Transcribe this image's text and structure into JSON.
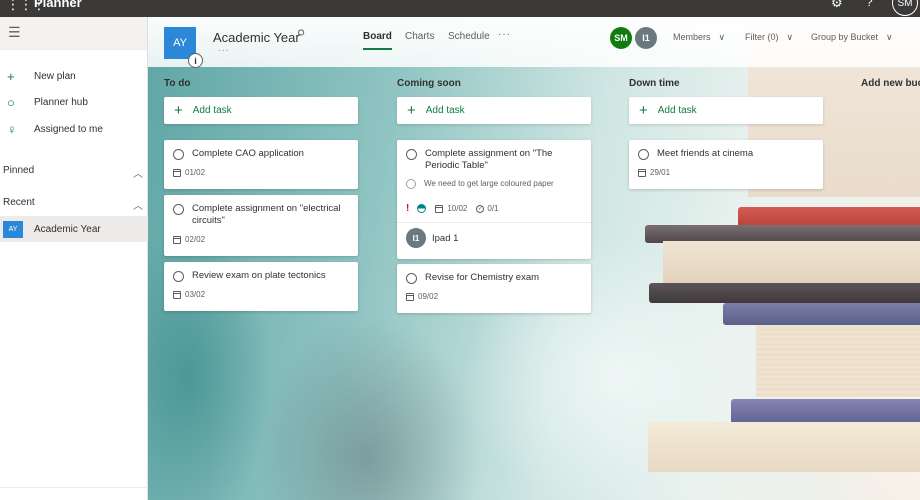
{
  "app": {
    "name": "Planner",
    "waffle_icon": "waffle-icon",
    "settings_icon": "gear-icon",
    "help_label": "?",
    "user_initials": "SM"
  },
  "sidebar": {
    "menu_icon": "hamburger-icon",
    "items": [
      {
        "label": "New plan",
        "icon": "plus-icon",
        "glyph": "+"
      },
      {
        "label": "Planner hub",
        "icon": "circle-icon",
        "glyph": "○"
      },
      {
        "label": "Assigned to me",
        "icon": "person-icon",
        "glyph": "♀"
      }
    ],
    "pinned_label": "Pinned",
    "recent_label": "Recent",
    "recent_items": [
      {
        "initials": "AY",
        "label": "Academic Year"
      }
    ]
  },
  "header": {
    "plan_initials": "AY",
    "plan_title": "Academic Year",
    "info_glyph": "i",
    "more_glyph": "...",
    "tabs": [
      {
        "label": "Board",
        "active": true
      },
      {
        "label": "Charts",
        "active": false
      },
      {
        "label": "Schedule",
        "active": false
      }
    ],
    "tabs_more": "···",
    "members": [
      {
        "initials": "SM",
        "color": "#107c10"
      },
      {
        "initials": "I1",
        "color": "#69797e"
      }
    ],
    "members_label": "Members",
    "filter_label": "Filter (0)",
    "group_label": "Group by Bucket"
  },
  "board": {
    "add_task_label": "Add task",
    "add_bucket_label": "Add new buck",
    "buckets": [
      {
        "name": "To do",
        "tasks": [
          {
            "title": "Complete CAO application",
            "due": "01/02"
          },
          {
            "title": "Complete assignment on \"electrical circuits\"",
            "due": "02/02"
          },
          {
            "title": "Review exam on plate tectonics",
            "due": "03/02"
          }
        ]
      },
      {
        "name": "Coming soon",
        "tasks": [
          {
            "title": "Complete assignment on \"The Periodic Table\"",
            "checklist_item": "We need to get large coloured paper",
            "priority_glyph": "!",
            "progress": "in progress",
            "due": "10/02",
            "checklist": "0/1",
            "assignee_initials": "I1",
            "assignee_name": "Ipad 1"
          },
          {
            "title": "Revise for Chemistry exam",
            "due": "09/02"
          }
        ]
      },
      {
        "name": "Down time",
        "tasks": [
          {
            "title": "Meet friends at cinema",
            "due": "29/01"
          }
        ]
      }
    ]
  }
}
